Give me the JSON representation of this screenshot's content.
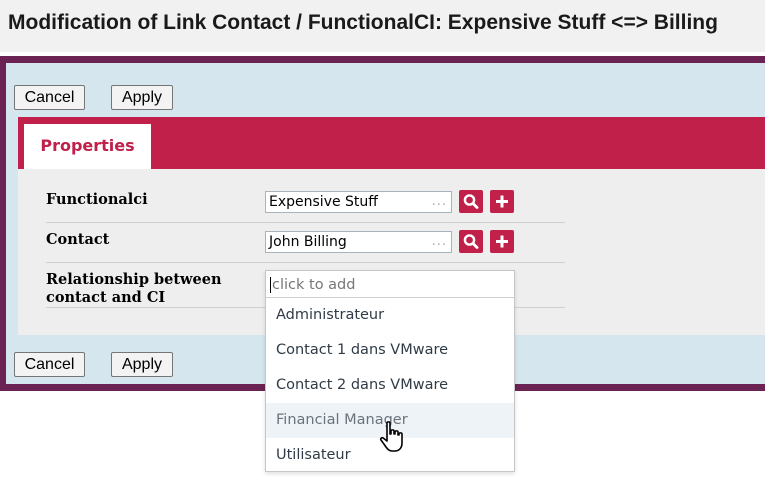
{
  "page": {
    "title": "Modification of Link Contact / FunctionalCI: Expensive Stuff <=> Billing"
  },
  "toolbar_top": {
    "cancel_label": "Cancel",
    "apply_label": "Apply"
  },
  "toolbar_bottom": {
    "cancel_label": "Cancel",
    "apply_label": "Apply"
  },
  "tabs": [
    {
      "label": "Properties",
      "active": true
    }
  ],
  "fields": {
    "functionalci": {
      "label": "Functionalci",
      "value": "Expensive Stuff",
      "dots": "..."
    },
    "contact": {
      "label": "Contact",
      "value": "John Billing",
      "dots": "..."
    },
    "relationship": {
      "label_line1": "Relationship between",
      "label_line2": "contact and CI",
      "placeholder": "click to add",
      "options": [
        "Administrateur",
        "Contact 1 dans VMware",
        "Contact 2 dans VMware",
        "Financial Manager",
        "Utilisateur"
      ],
      "hovered_option": "Financial Manager"
    }
  },
  "icons": {
    "search": "search-icon",
    "add": "plus-icon",
    "cursor": "hand-pointer-icon"
  },
  "colors": {
    "accent": "#c0204a",
    "frame": "#6b2353",
    "form_background": "#d5e6ef",
    "panel_background": "#eeeeee"
  }
}
